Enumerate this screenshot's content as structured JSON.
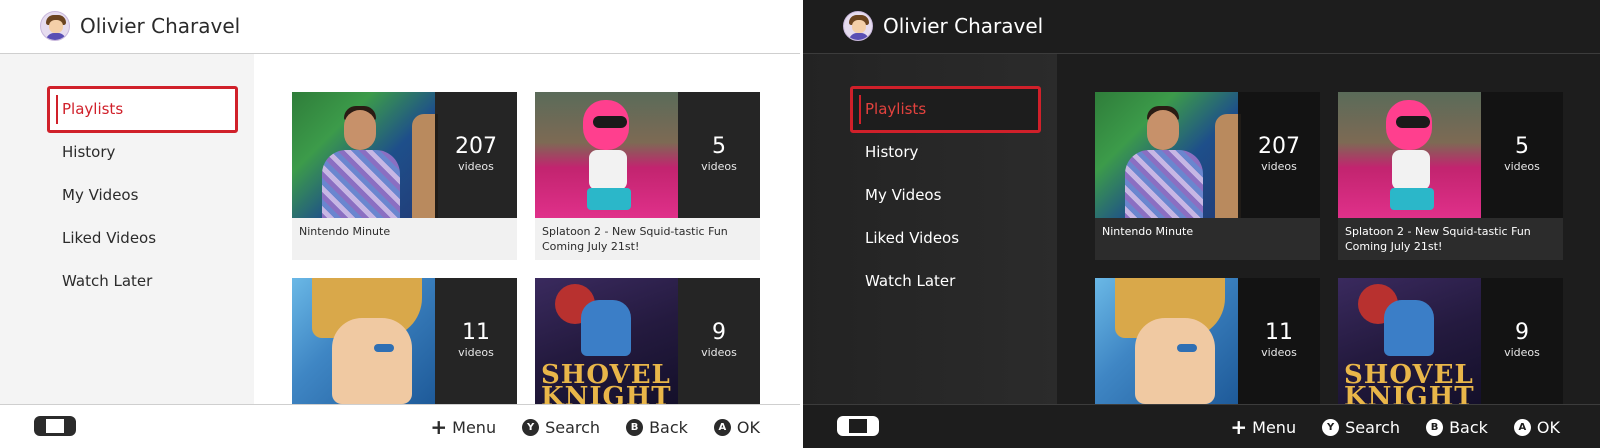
{
  "user": {
    "name": "Olivier Charavel"
  },
  "nav": {
    "items": [
      {
        "label": "Playlists"
      },
      {
        "label": "History"
      },
      {
        "label": "My Videos"
      },
      {
        "label": "Liked Videos"
      },
      {
        "label": "Watch Later"
      }
    ],
    "selected": "Playlists"
  },
  "playlists": [
    {
      "title": "Nintendo Minute",
      "count": "207",
      "unit": "videos"
    },
    {
      "title": "Splatoon 2 - New Squid-tastic Fun Coming July 21st!",
      "count": "5",
      "unit": "videos"
    },
    {
      "title": "",
      "count": "11",
      "unit": "videos"
    },
    {
      "title": "",
      "count": "9",
      "unit": "videos"
    }
  ],
  "thumb_text": {
    "shovel_knight_logo": "SHOVEL KNIGHT"
  },
  "footer": {
    "menu": {
      "glyph": "+",
      "label": "Menu"
    },
    "search": {
      "glyph": "Y",
      "label": "Search"
    },
    "back": {
      "glyph": "B",
      "label": "Back"
    },
    "ok": {
      "glyph": "A",
      "label": "OK"
    }
  },
  "themes": {
    "light": {
      "background": "#ffffff",
      "accent": "#d0202a"
    },
    "dark": {
      "background": "#1d1d1d",
      "accent": "#d0202a"
    }
  },
  "icons": {
    "avatar": "mii-avatar-icon",
    "console": "switch-console-icon"
  }
}
